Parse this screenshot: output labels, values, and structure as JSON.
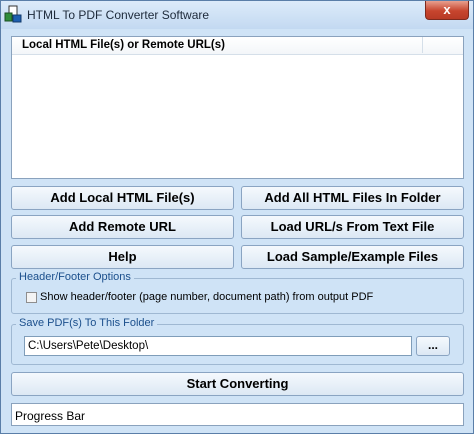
{
  "window": {
    "title": "HTML To PDF Converter Software",
    "close_label": "x"
  },
  "file_list": {
    "column_header": "Local HTML File(s) or Remote URL(s)",
    "items": []
  },
  "buttons": {
    "add_local": "Add Local HTML File(s)",
    "add_all_folder": "Add All HTML Files In Folder",
    "add_remote": "Add Remote URL",
    "load_urls_text": "Load URL/s From Text File",
    "help": "Help",
    "load_samples": "Load Sample/Example Files",
    "start": "Start Converting",
    "browse": "..."
  },
  "header_footer": {
    "group_label": "Header/Footer Options",
    "checkbox_label": "Show header/footer (page number, document path) from output PDF",
    "checked": false
  },
  "save_folder": {
    "group_label": "Save PDF(s) To This Folder",
    "path": "C:\\Users\\Pete\\Desktop\\"
  },
  "progress": {
    "label": "Progress Bar"
  }
}
